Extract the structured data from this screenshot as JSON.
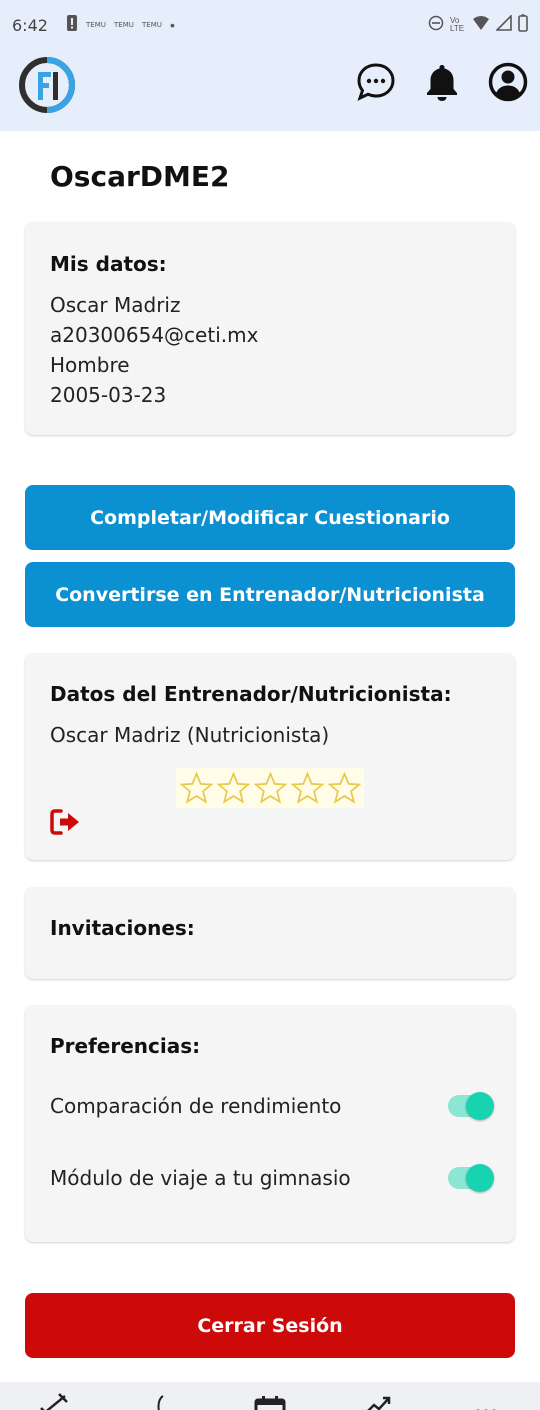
{
  "status_bar": {
    "time": "6:42",
    "notif_badges": [
      "TEMU",
      "TEMU",
      "TEMU"
    ],
    "network": "Vo LTE"
  },
  "header": {
    "logo_text": "FI",
    "icons": [
      "chat-icon",
      "bell-icon",
      "account-icon"
    ]
  },
  "profile": {
    "username": "OscarDME2"
  },
  "my_data": {
    "title": "Mis datos:",
    "name": "Oscar Madriz",
    "email": "a20300654@ceti.mx",
    "gender": "Hombre",
    "birthdate": "2005-03-23"
  },
  "buttons": {
    "questionnaire": "Completar/Modificar Cuestionario",
    "become_trainer": "Convertirse en Entrenador/Nutricionista",
    "logout": "Cerrar Sesión"
  },
  "trainer_data": {
    "title": "Datos del Entrenador/Nutricionista:",
    "entry": "Oscar Madriz (Nutricionista)",
    "rating": 0,
    "rating_max": 5
  },
  "invitations": {
    "title": "Invitaciones:"
  },
  "preferences": {
    "title": "Preferencias:",
    "items": [
      {
        "label": "Comparación de rendimiento",
        "enabled": true
      },
      {
        "label": "Módulo de viaje a tu gimnasio",
        "enabled": true
      }
    ]
  },
  "colors": {
    "header_bg": "#e5eefa",
    "primary": "#0b90d1",
    "danger": "#cc0a0a",
    "toggle_on": "#17d3b0",
    "star_outline": "#e8c84a"
  }
}
